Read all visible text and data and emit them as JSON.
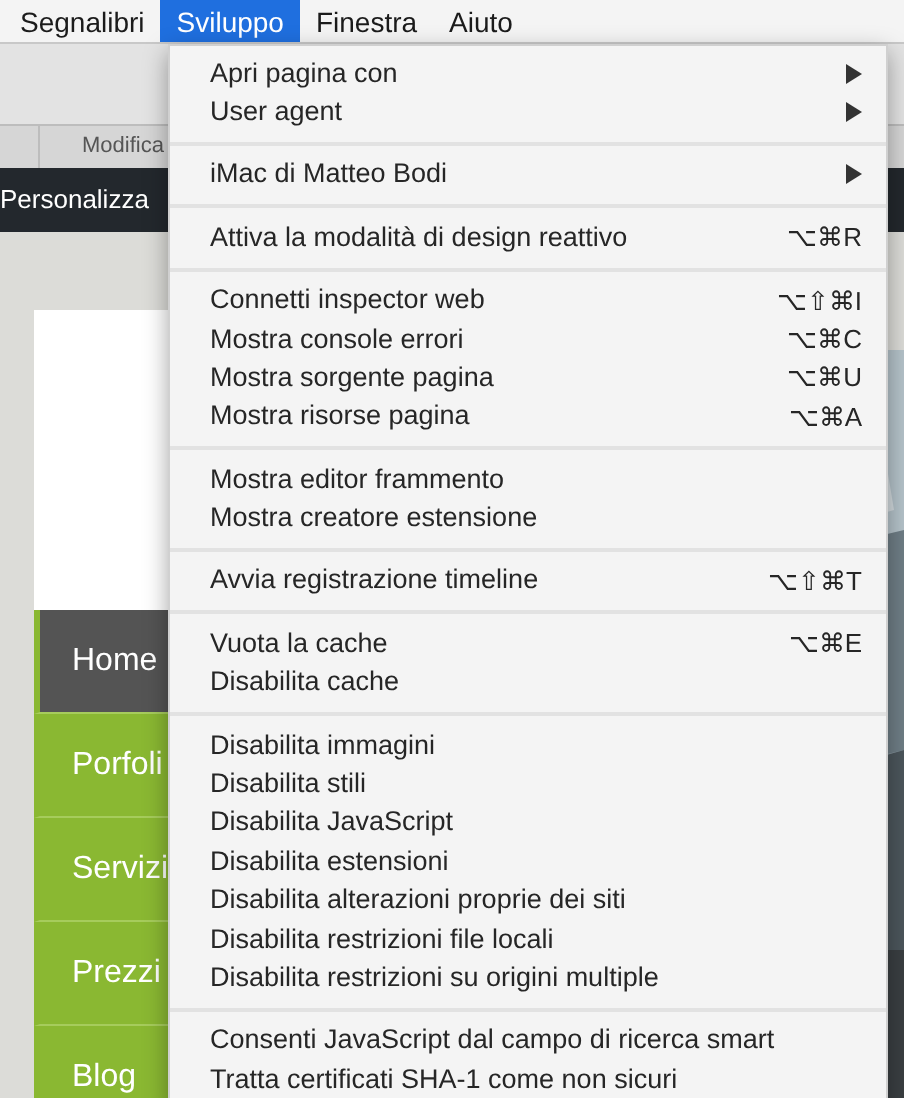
{
  "menubar": [
    {
      "label": "Segnalibri",
      "selected": false
    },
    {
      "label": "Sviluppo",
      "selected": true
    },
    {
      "label": "Finestra",
      "selected": false
    },
    {
      "label": "Aiuto",
      "selected": false
    }
  ],
  "tab_bar": {
    "tab": "Modifica"
  },
  "admin_bar": {
    "label": "Personalizza"
  },
  "site_nav": [
    {
      "label": "Home",
      "selected": true
    },
    {
      "label": "Porfoli",
      "selected": false
    },
    {
      "label": "Servizi",
      "selected": false
    },
    {
      "label": "Prezzi",
      "selected": false
    },
    {
      "label": "Blog",
      "selected": false
    }
  ],
  "menu": [
    [
      {
        "label": "Apri pagina con",
        "submenu": true
      },
      {
        "label": "User agent",
        "submenu": true
      }
    ],
    [
      {
        "label": "iMac di Matteo Bodi",
        "submenu": true
      }
    ],
    [
      {
        "label": "Attiva la modalità di design reattivo",
        "shortcut": "⌥⌘R"
      }
    ],
    [
      {
        "label": "Connetti inspector web",
        "shortcut": "⌥⇧⌘I"
      },
      {
        "label": "Mostra console errori",
        "shortcut": "⌥⌘C"
      },
      {
        "label": "Mostra sorgente pagina",
        "shortcut": "⌥⌘U"
      },
      {
        "label": "Mostra risorse pagina",
        "shortcut": "⌥⌘A"
      }
    ],
    [
      {
        "label": "Mostra editor frammento"
      },
      {
        "label": "Mostra creatore estensione"
      }
    ],
    [
      {
        "label": "Avvia registrazione timeline",
        "shortcut": "⌥⇧⌘T"
      }
    ],
    [
      {
        "label": "Vuota la cache",
        "shortcut": "⌥⌘E"
      },
      {
        "label": "Disabilita cache"
      }
    ],
    [
      {
        "label": "Disabilita immagini"
      },
      {
        "label": "Disabilita stili"
      },
      {
        "label": "Disabilita JavaScript"
      },
      {
        "label": "Disabilita estensioni"
      },
      {
        "label": "Disabilita alterazioni proprie dei siti"
      },
      {
        "label": "Disabilita restrizioni file locali"
      },
      {
        "label": "Disabilita restrizioni su origini multiple"
      }
    ],
    [
      {
        "label": "Consenti JavaScript dal campo di ricerca smart"
      },
      {
        "label": "Tratta certificati SHA-1 come non sicuri"
      }
    ]
  ]
}
